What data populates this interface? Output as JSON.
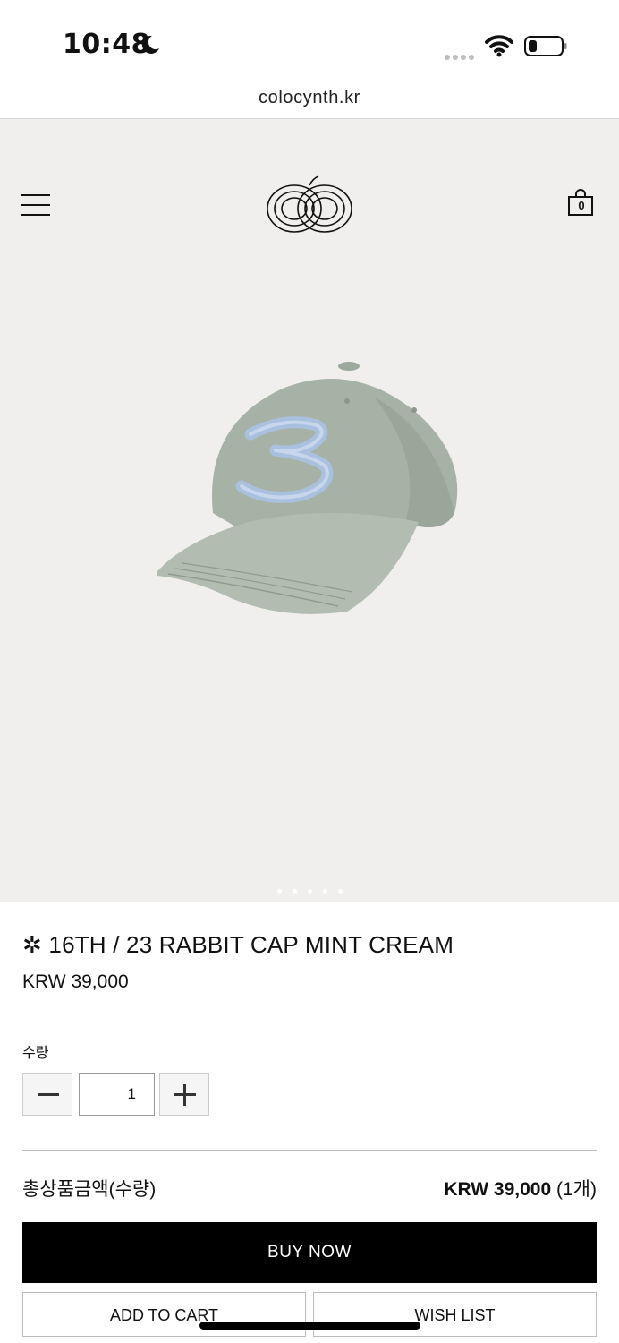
{
  "status_bar": {
    "time": "10:48"
  },
  "browser": {
    "url": "colocynth.kr"
  },
  "header": {
    "cart_count": "0"
  },
  "product": {
    "title": "✲ 16TH / 23 RABBIT CAP MINT CREAM",
    "price": "KRW 39,000",
    "image_colors": {
      "cap": "#a7b2a6",
      "embroidery": "#a9c0de"
    }
  },
  "quantity": {
    "label": "수량",
    "value": "1"
  },
  "total": {
    "label": "총상품금액(수량)",
    "amount": "KRW 39,000",
    "count": "(1개)"
  },
  "actions": {
    "buy_now": "BUY NOW",
    "add_to_cart": "ADD TO CART",
    "wish_list": "WISH LIST"
  }
}
